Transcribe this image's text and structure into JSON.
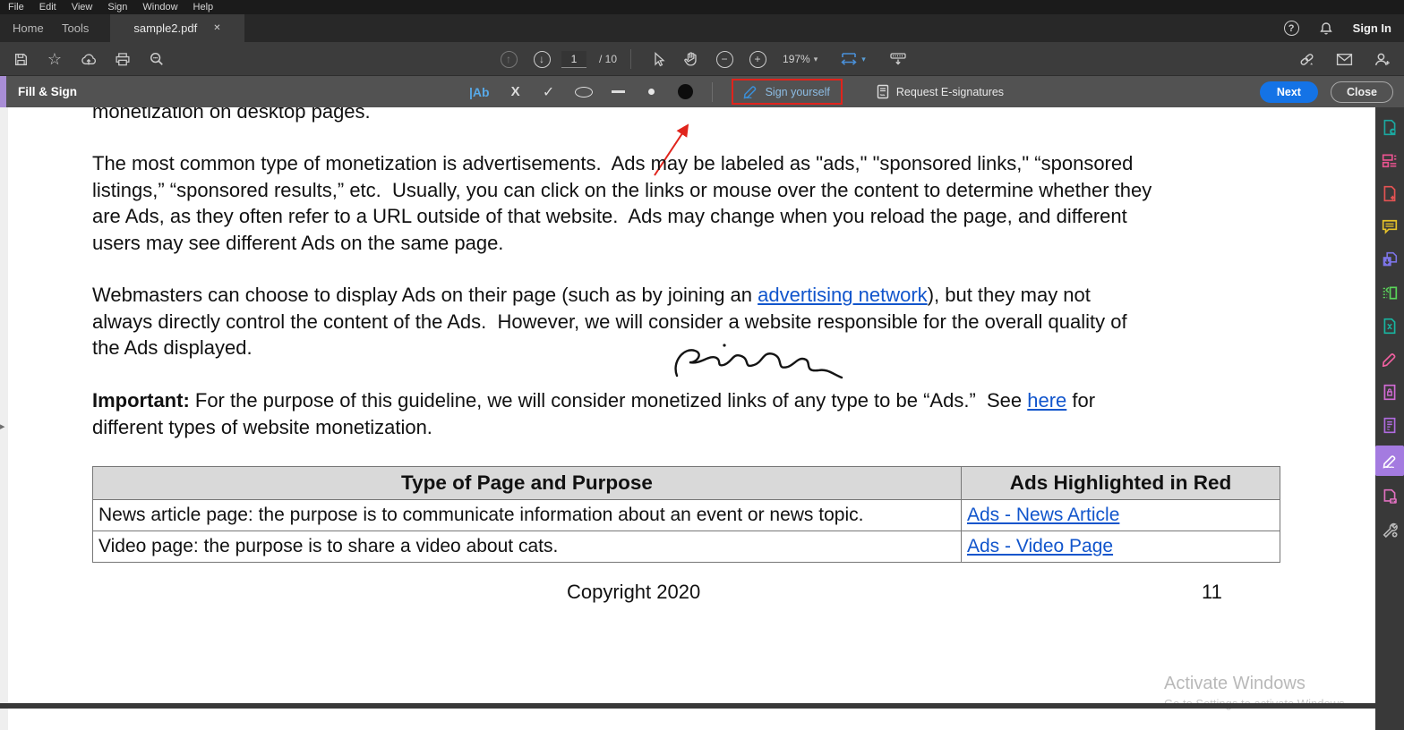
{
  "app": {
    "menu": [
      "File",
      "Edit",
      "View",
      "Sign",
      "Window",
      "Help"
    ],
    "tabs": {
      "home": "Home",
      "tools": "Tools",
      "document": "sample2.pdf",
      "close_glyph": "✕"
    },
    "help_glyph": "?",
    "sign_in": "Sign In"
  },
  "toolbar": {
    "page_current": "1",
    "page_total": "/ 10",
    "zoom_level": "197%"
  },
  "fill_sign": {
    "title": "Fill & Sign",
    "text_tool_label": "|Ab",
    "cross_glyph": "X",
    "check_glyph": "✓",
    "sign_yourself_label": "Sign yourself",
    "request_label": "Request E-signatures",
    "next_label": "Next",
    "close_label": "Close"
  },
  "doc": {
    "clipped_line": "monetization on desktop pages.",
    "p1": [
      "The most common type of monetization is advertisements.  Ads may be labeled as \"ads,\" \"sponsored links,\" “sponsored",
      "listings,” “sponsored results,” etc.  Usually, you can click on the links or mouse over the content to determine whether they",
      "are Ads, as they often refer to a URL outside of that website.  Ads may change when you reload the page, and different",
      "users may see different Ads on the same page."
    ],
    "p2_pre": "Webmasters can choose to display Ads on their page (such as by joining an ",
    "p2_link": "advertising network",
    "p2_post": "), but they may not",
    "p2_l2": "always directly control the content of the Ads.  However, we will consider a website responsible for the overall quality of",
    "p2_l3": "the Ads displayed.",
    "imp_bold": "Important:",
    "imp_text": " For the purpose of this guideline, we will consider monetized links of any type to be “Ads.”  See ",
    "imp_link": "here",
    "imp_post": " for",
    "imp_l2": "different types of website monetization.",
    "table": {
      "headers": [
        "Type of Page and Purpose",
        "Ads Highlighted in Red"
      ],
      "rows": [
        {
          "desc": "News article page: the purpose is to communicate information about an event or news topic.",
          "link": "Ads - News Article"
        },
        {
          "desc": "Video page: the purpose is to share a video about cats.",
          "link": "Ads - Video Page"
        }
      ]
    },
    "footer": {
      "copyright": "Copyright 2020",
      "page_number": "11"
    }
  },
  "watermark": {
    "line1": "Activate Windows",
    "line2": "Go to Settings to activate Windows."
  },
  "sidebar": {
    "items": [
      {
        "name": "export-pdf",
        "color": "#1ba8a0"
      },
      {
        "name": "edit-pdf",
        "color": "#e8538f"
      },
      {
        "name": "create-pdf",
        "color": "#e55353"
      },
      {
        "name": "comment",
        "color": "#e6c229"
      },
      {
        "name": "combine-files",
        "color": "#7d75e8"
      },
      {
        "name": "organize-pages",
        "color": "#5ad45a"
      },
      {
        "name": "compress-pdf",
        "color": "#18b5a0"
      },
      {
        "name": "redact",
        "color": "#f060a0"
      },
      {
        "name": "protect",
        "color": "#d36bd6"
      },
      {
        "name": "prepare-form",
        "color": "#b06be0"
      },
      {
        "name": "fill-sign",
        "color": "#ffffff"
      },
      {
        "name": "send-for-review",
        "color": "#e070c0"
      },
      {
        "name": "more-tools",
        "color": "#b8b8b8"
      }
    ]
  },
  "colors": {
    "accent_blue": "#1473e6",
    "annotation_red": "#e0241c",
    "link_blue": "#1155cc",
    "sidebar_active_bg": "#a47be0",
    "fill_sign_strip": "#a98ed6",
    "tool_blue": "#4a90d9"
  }
}
